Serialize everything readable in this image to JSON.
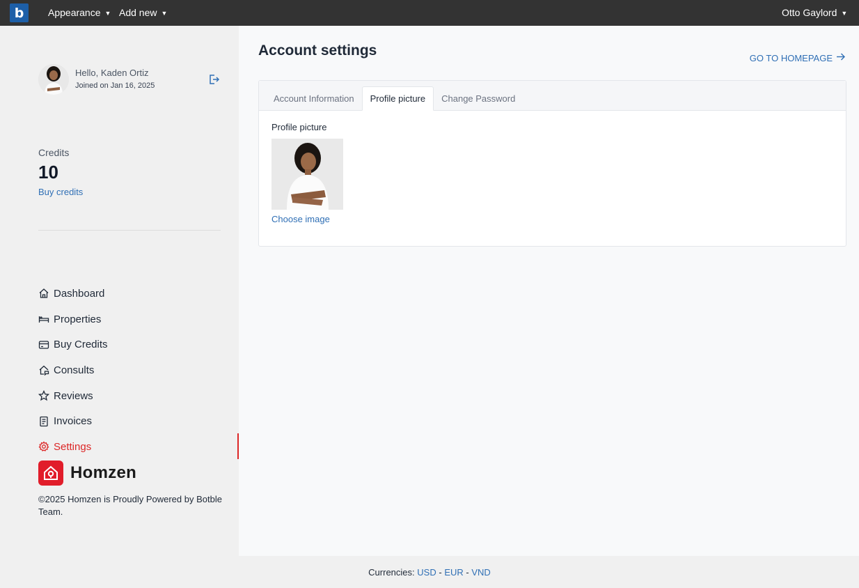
{
  "topbar": {
    "brand_letter": "b",
    "appearance_label": "Appearance",
    "add_new_label": "Add new",
    "user_name": "Otto Gaylord"
  },
  "profile": {
    "greeting": "Hello, Kaden Ortiz",
    "joined": "Joined on Jan 16, 2025"
  },
  "credits": {
    "label": "Credits",
    "value": "10",
    "buy_link": "Buy credits"
  },
  "nav": {
    "items": [
      {
        "label": "Dashboard",
        "icon": "home-icon"
      },
      {
        "label": "Properties",
        "icon": "bed-icon"
      },
      {
        "label": "Buy Credits",
        "icon": "credit-card-icon"
      },
      {
        "label": "Consults",
        "icon": "house-chat-icon"
      },
      {
        "label": "Reviews",
        "icon": "star-icon"
      },
      {
        "label": "Invoices",
        "icon": "receipt-icon"
      },
      {
        "label": "Settings",
        "icon": "gear-icon",
        "active": true
      }
    ]
  },
  "brand": {
    "name": "Homzen",
    "copyright": "©2025 Homzen is Proudly Powered by Botble Team."
  },
  "main": {
    "title": "Account settings",
    "goto_homepage": "GO TO HOMEPAGE",
    "tabs": [
      {
        "label": "Account Information",
        "active": false
      },
      {
        "label": "Profile picture",
        "active": true
      },
      {
        "label": "Change Password",
        "active": false
      }
    ],
    "profile_picture_label": "Profile picture",
    "choose_image": "Choose image"
  },
  "footer": {
    "currencies_label": "Currencies:",
    "currencies": [
      "USD",
      "EUR",
      "VND"
    ],
    "separator": "-"
  },
  "colors": {
    "accent": "#2f6fb5",
    "active": "#dc2626",
    "topbar": "#333333",
    "brand_red": "#e11d2a"
  }
}
